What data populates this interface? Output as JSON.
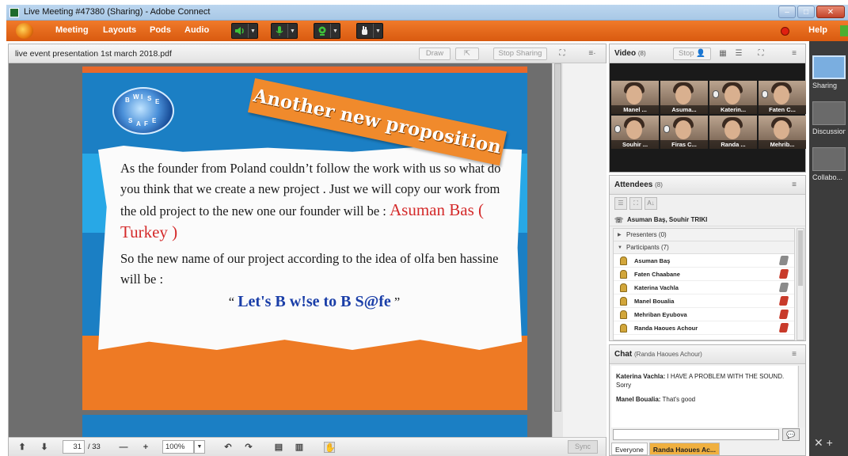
{
  "window": {
    "title": "Live Meeting #47380 (Sharing) - Adobe Connect",
    "controls": [
      "–",
      "□",
      "✕"
    ]
  },
  "menubar": {
    "items": [
      "Meeting",
      "Layouts",
      "Pods",
      "Audio"
    ],
    "help": "Help"
  },
  "share_pod": {
    "title": "live event presentation 1st march 2018.pdf",
    "draw_label": "Draw",
    "stop_sharing_label": "Stop Sharing",
    "menu_glyph": "≡·"
  },
  "slide": {
    "logo_letters": [
      "B",
      "W",
      "I",
      "S",
      "E",
      "S",
      "A",
      "F",
      "E"
    ],
    "banner": "Another new proposition",
    "paragraph1": "As the founder from Poland couldn’t follow the work with us so what do you think that we create a new project . Just we will copy our work from the old project to the new one our founder will be :",
    "founder_name": "Asuman Bas ( Turkey )",
    "paragraph2": "So the new name of our project according to the idea of olfa ben hassine will be :",
    "slogan_open": "“",
    "slogan": "Let's B w!se to B S@fe",
    "slogan_close": "”"
  },
  "doc_toolbar": {
    "page_current": "31",
    "page_total": "/ 33",
    "zoom": "100%",
    "sync_label": "Sync"
  },
  "video_pod": {
    "title": "Video",
    "count": "(8)",
    "stop_label": "Stop",
    "tiles": [
      {
        "name": "Manel ..."
      },
      {
        "name": "Asuma..."
      },
      {
        "name": "Katerin..."
      },
      {
        "name": "Faten C..."
      },
      {
        "name": "Souhir ..."
      },
      {
        "name": "Firas C..."
      },
      {
        "name": "Randa ..."
      },
      {
        "name": "Mehrib..."
      }
    ]
  },
  "attendees_pod": {
    "title": "Attendees",
    "count": "(8)",
    "hosts": "Asuman Baş, Souhir TRIKI",
    "presenters_group": "Presenters (0)",
    "participants_group": "Participants (7)",
    "participants": [
      {
        "name": "Asuman Baş",
        "status": "muted"
      },
      {
        "name": "Faten Chaabane",
        "status": "active"
      },
      {
        "name": "Katerina Vachla",
        "status": "muted"
      },
      {
        "name": "Manel Boualia",
        "status": "active"
      },
      {
        "name": "Mehriban Eyubova",
        "status": "active"
      },
      {
        "name": "Randa Haoues Achour",
        "status": "active"
      }
    ]
  },
  "chat_pod": {
    "title": "Chat",
    "subtitle": "(Randa Haoues Achour)",
    "messages": [
      {
        "sender": "Katerina Vachla:",
        "text": " I HAVE A PROBLEM WITH THE SOUND. Sorry"
      },
      {
        "sender": "Manel Boualia:",
        "text": " That's good"
      }
    ],
    "tabs": [
      "Everyone",
      "Randa Haoues Ac..."
    ]
  },
  "layouts_bar": {
    "items": [
      "Sharing",
      "Discussion",
      "Collabo..."
    ]
  },
  "colors": {
    "menubar": "#e8681c",
    "slide_blue": "#1b7fc4",
    "slide_orange": "#ee7a24",
    "founder_name": "#d42a2a",
    "slogan": "#1a3ea8"
  }
}
